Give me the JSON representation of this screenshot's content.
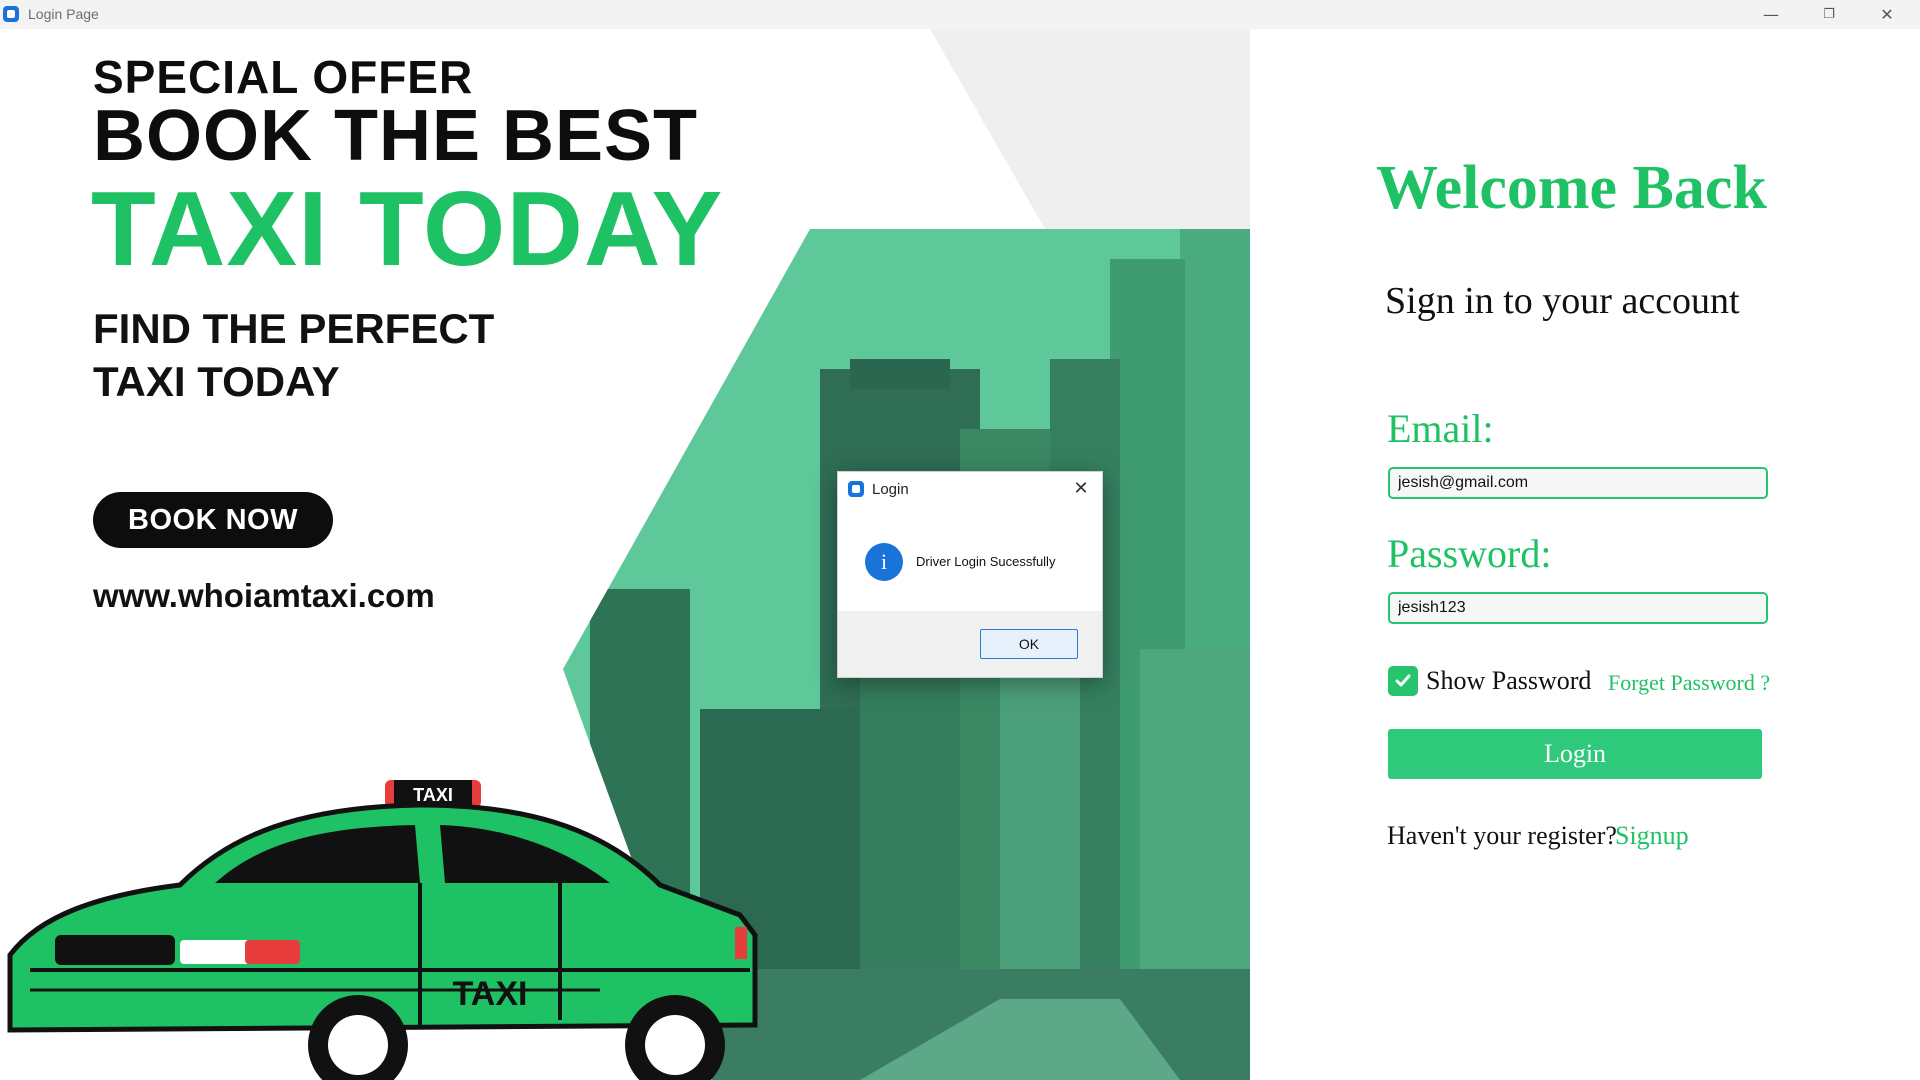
{
  "window": {
    "title": "Login Page",
    "minimize_icon": "minimize-icon",
    "maximize_icon": "restore-icon",
    "close_icon": "close-icon"
  },
  "banner": {
    "offer_small": "SPECIAL OFFER",
    "offer_big": "BOOK THE BEST",
    "offer_taxi": "TAXI TODAY",
    "find_line1": "FIND THE PERFECT",
    "find_line2": "TAXI TODAY",
    "book_button": "BOOK NOW",
    "website": "www.whoiamtaxi.com",
    "car_sign": "TAXI",
    "car_door_text": "TAXI",
    "accent_color": "#1ec264"
  },
  "login": {
    "welcome": "Welcome Back",
    "subtitle": "Sign in to your account",
    "email_label": "Email:",
    "email_value": "jesish@gmail.com",
    "password_label": "Password:",
    "password_value": "jesish123",
    "show_password_label": "Show Password",
    "show_password_checked": true,
    "forget_password": "Forget Password ?",
    "login_button": "Login",
    "no_account_text": "Haven't your register?",
    "signup_link": "Signup",
    "accent_color": "#1ec264",
    "button_color": "#2fc97b"
  },
  "dialog": {
    "title": "Login",
    "message": "Driver Login Sucessfully",
    "ok_button": "OK",
    "info_icon": "info-icon",
    "info_glyph": "i"
  }
}
